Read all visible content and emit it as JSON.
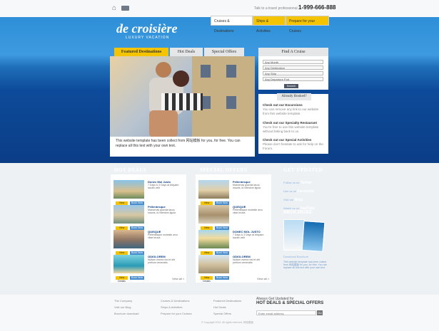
{
  "topbar": {
    "home_icon": "home-icon",
    "mail_icon": "mail-icon",
    "talk": "Talk to a travel professional",
    "phone": "1-999-666-888"
  },
  "brand": {
    "name": "de croisière",
    "tagline": "LUXURY VACATION"
  },
  "nav": {
    "items": [
      "Cruises & Destinations",
      "Ships & Activities",
      "Prepare for your Cruises"
    ]
  },
  "tabs": [
    "Featured Destinations",
    "Hot Deals",
    "Special Offers"
  ],
  "hero": {
    "caption": "This website template has been collect from 网站模板 for you, for free. You can replace all this text with your own text."
  },
  "find": {
    "title": "Find A Cruise",
    "options": [
      "Any Month",
      "Any Destination",
      "Any Ship",
      "Any Departure Port"
    ],
    "search": "Search"
  },
  "booked": {
    "title": "Already Booked?",
    "items": [
      {
        "title": "Check out our Excursions",
        "text": "You can remove any link to our website from this website template."
      },
      {
        "title": "Check out our Specialty Restaurant",
        "text": "You're free to use this website template without linking back to us."
      },
      {
        "title": "Check out our Special Activities",
        "text": "Please don't hesitate to ask for help on the Forum."
      }
    ]
  },
  "sections": {
    "hot_deals": "HOT DEALS",
    "special_offers": "SPECIAL OFFERS",
    "get_updated": "GET UPDATED",
    "brochure": "BROCHURE"
  },
  "hot_deals": {
    "rows": [
      {
        "title": "Donec Mol Justo",
        "text": "7 Days & 3 Days at Aliquam iaculis velit",
        "btn1": "View Details",
        "btn2": "Book Now"
      },
      {
        "title": "Pellentesque",
        "text": "Maecenas gravida lacus mauris, id interdum ligula",
        "btn1": "View Details",
        "btn2": "Book Now"
      },
      {
        "title": "QUISQUE",
        "text": "Pellentesque molestie arcu vitae lectus",
        "btn1": "View Details",
        "btn2": "Book Now"
      },
      {
        "title": "ODIOLOREM",
        "text": "Nullam viverra nisi et elit pretium venenatis",
        "btn1": "View Details",
        "btn2": "Book Now"
      }
    ],
    "view": "View all >"
  },
  "special_offers": {
    "rows": [
      {
        "title": "Pellentesque",
        "text": "Maecenas gravida lacus mauris, id interdum ligula",
        "btn1": "View Details",
        "btn2": "Book Now"
      },
      {
        "title": "QUISQUE",
        "text": "Pellentesque molestie arcu vitae lectus",
        "btn1": "View Details",
        "btn2": "Book Now"
      },
      {
        "title": "DONEC MOL JUSTO",
        "text": "7 Days & 3 Days at Aliquam iaculis velit",
        "btn1": "View Details",
        "btn2": "Book Now"
      },
      {
        "title": "ODIOLOREM",
        "text": "Nullam viverra nisi et elit pretium venenatis",
        "btn1": "View Details",
        "btn2": "Book Now"
      }
    ],
    "view": "View all >"
  },
  "updated": {
    "items": [
      {
        "prefix": "Follow us on",
        "name": "Twitter"
      },
      {
        "prefix": "Like us on",
        "name": "Facebook"
      },
      {
        "prefix": "Visit our",
        "name": "Blog"
      },
      {
        "prefix": "Watch us on",
        "name": "YouTube"
      }
    ]
  },
  "brochure": {
    "download": "Download Brochure",
    "text": "This website template has been collect from 网站模板 for you, for free. You can replace all this text with your own text."
  },
  "footer": {
    "col1": [
      "The Company",
      "Visit our Blog",
      "Brochure download"
    ],
    "col2": [
      "Cruises & Destinations",
      "Ships & Activities",
      "Prepare for your Cruises"
    ],
    "col3": [
      "Featured Destinations",
      "Hot Deals",
      "Special Offers"
    ],
    "newsletter_intro": "Always Get Updated for",
    "newsletter_title": "HOT DEALS & SPECIAL OFFERS",
    "email_placeholder": "Enter email address",
    "go": "Go",
    "copyright": "© Copyright 2012. All rights reserved. 网站模板"
  }
}
